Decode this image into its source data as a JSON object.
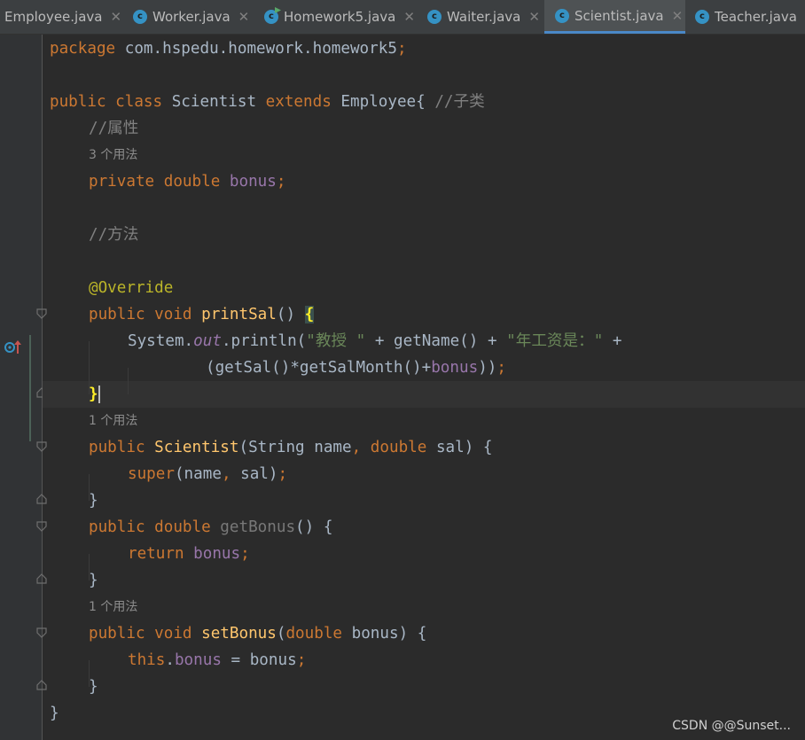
{
  "tabs": [
    {
      "label": "Employee.java",
      "icon": "class-icon",
      "active": false
    },
    {
      "label": "Worker.java",
      "icon": "class-icon",
      "active": false
    },
    {
      "label": "Homework5.java",
      "icon": "main-class-icon",
      "active": false
    },
    {
      "label": "Waiter.java",
      "icon": "class-icon",
      "active": false
    },
    {
      "label": "Scientist.java",
      "icon": "class-icon",
      "active": true
    },
    {
      "label": "Teacher.java",
      "icon": "class-icon",
      "active": false
    }
  ],
  "close_glyph": "✕",
  "icon_letter": "c",
  "code": {
    "l1": "package com.hspedu.homework.homework5;",
    "l3_class_decl": "public class Scientist extends Employee{",
    "l3_comment": "//子类",
    "l4_comment": "//属性",
    "usage_3": "3 个用法",
    "l5": "private double bonus;",
    "l7_comment": "//方法",
    "l9_annotation": "@Override",
    "l10": "public void printSal() {",
    "l11": "System.out.println(\"教授 \" + getName() + \"年工资是：\" +",
    "l12": "(getSal()*getSalMonth()+bonus));",
    "l13": "}",
    "usage_1a": "1 个用法",
    "l14": "public Scientist(String name, double sal) {",
    "l15": "super(name, sal);",
    "l16": "}",
    "l17": "public double getBonus() {",
    "l18": "return bonus;",
    "l19": "}",
    "usage_1b": "1 个用法",
    "l20": "public void setBonus(double bonus) {",
    "l21": "this.bonus = bonus;",
    "l22": "}",
    "l23": "}"
  },
  "watermark": "CSDN @@Sunset...",
  "colors": {
    "background": "#2b2b2b",
    "keyword": "#cc7832",
    "field": "#9876aa",
    "function": "#ffc66d",
    "string": "#6a8759",
    "comment": "#808080",
    "annotation": "#bbb529",
    "active_tab_underline": "#4a88c7"
  }
}
